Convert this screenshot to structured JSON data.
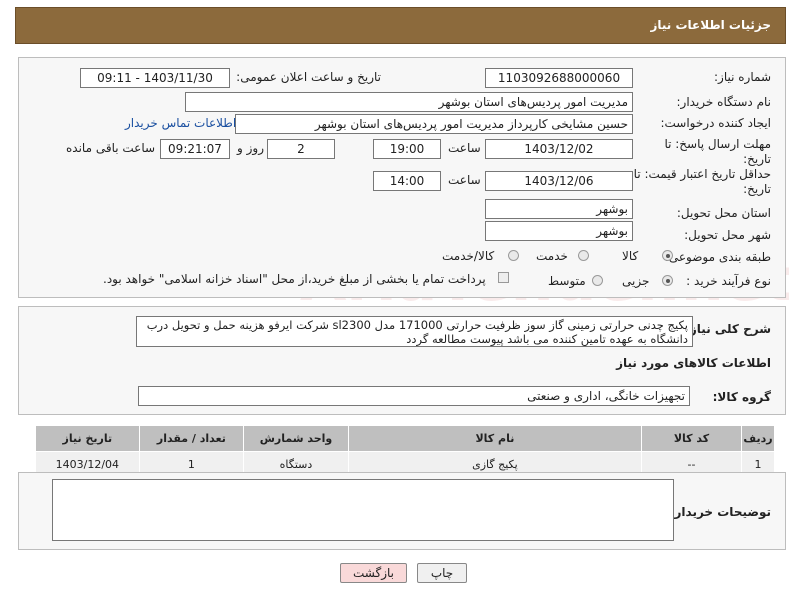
{
  "header": {
    "title": "جزئیات اطلاعات نیاز"
  },
  "form": {
    "need_number_label": "شماره نیاز:",
    "need_number": "1103092688000060",
    "announce_label": "تاریخ و ساعت اعلان عمومی:",
    "announce_value": "1403/11/30 - 09:11",
    "buyer_org_label": "نام دستگاه خریدار:",
    "buyer_org": "مدیریت امور پردیس‌های استان بوشهر",
    "creator_label": "ایجاد کننده درخواست:",
    "creator": "حسین مشایخی کارپرداز مدیریت امور پردیس‌های استان بوشهر",
    "contact_link": "اطلاعات تماس خریدار",
    "deadline_label": "مهلت ارسال پاسخ: تا تاریخ:",
    "deadline_date": "1403/12/02",
    "time_label": "ساعت",
    "deadline_time": "19:00",
    "days_value": "2",
    "days_label": "روز و",
    "remaining_time": "09:21:07",
    "remaining_label": "ساعت باقی مانده",
    "validity_label": "حداقل تاریخ اعتبار قیمت: تا تاریخ:",
    "validity_date": "1403/12/06",
    "validity_time": "14:00",
    "province_label": "استان محل تحویل:",
    "province": "بوشهر",
    "city_label": "شهر محل تحویل:",
    "city": "بوشهر",
    "category_label": "طبقه بندی موضوعی:",
    "category_options": [
      "کالا",
      "خدمت",
      "کالا/خدمت"
    ],
    "process_label": "نوع فرآیند خرید :",
    "process_options": [
      "جزیی",
      "متوسط"
    ],
    "payment_note": "پرداخت تمام یا بخشی از مبلغ خرید،از محل \"اسناد خزانه اسلامی\" خواهد بود."
  },
  "description": {
    "label": "شرح کلی نیاز:",
    "text": "پکیج چدنی حرارتی زمینی گاز سوز ظرفیت حرارتی 171000 مدل sl2300 شرکت ایرفو هزینه حمل و تحویل درب دانشگاه به عهده تامین کننده می باشد پیوست مطالعه گردد"
  },
  "goods": {
    "section_title": "اطلاعات کالاهای مورد نیاز",
    "group_label": "گروه کالا:",
    "group_value": "تجهیزات خانگی، اداری و صنعتی",
    "columns": [
      "ردیف",
      "کد کالا",
      "نام کالا",
      "واحد شمارش",
      "تعداد / مقدار",
      "تاریخ نیاز"
    ],
    "rows": [
      [
        "1",
        "--",
        "پکیج گازی",
        "دستگاه",
        "1",
        "1403/12/04"
      ]
    ]
  },
  "buyer_notes": {
    "label": "توضیحات خریدار:",
    "value": ""
  },
  "buttons": {
    "print": "چاپ",
    "back": "بازگشت"
  },
  "watermark": "AriaTender.net",
  "colors": {
    "header_bg": "#8c6a3c",
    "back_button_bg": "#f9d9d9",
    "link": "#1a4fa0"
  }
}
